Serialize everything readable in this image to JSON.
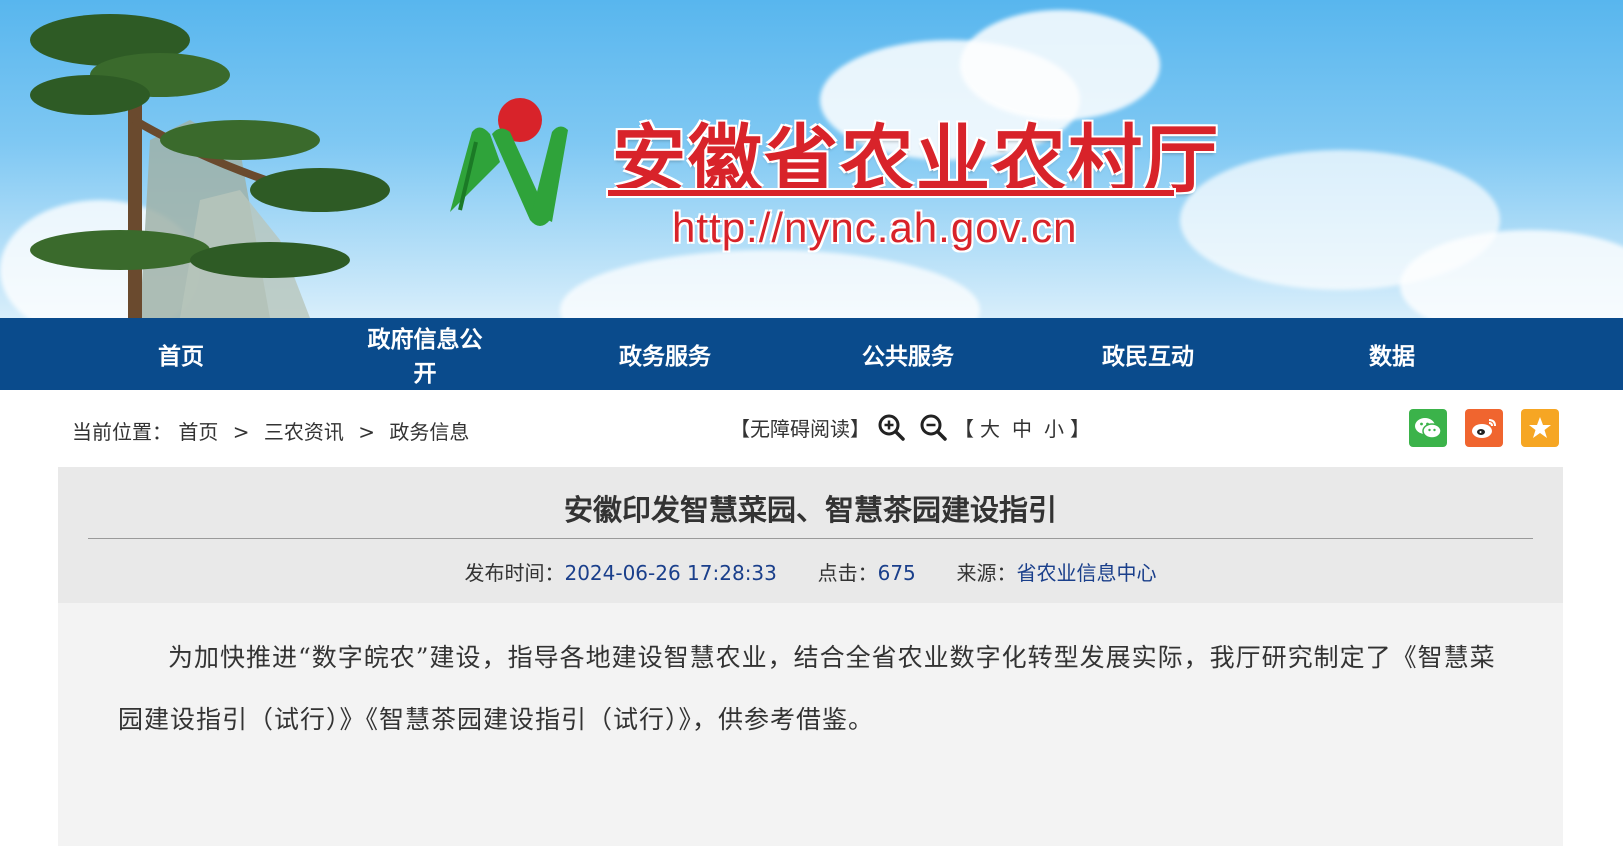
{
  "header": {
    "site_title": "安徽省农业农村厅",
    "site_url": "http://nync.ah.gov.cn"
  },
  "nav": {
    "items": [
      {
        "label": "首页"
      },
      {
        "label": "政府信息公开"
      },
      {
        "label": "政务服务"
      },
      {
        "label": "公共服务"
      },
      {
        "label": "政民互动"
      },
      {
        "label": "数据"
      }
    ]
  },
  "breadcrumb": {
    "prefix": "当前位置：",
    "items": [
      "首页",
      "三农资讯",
      "政务信息"
    ],
    "separator": ">"
  },
  "accessibility": {
    "barrier_free": "【无障碍阅读】",
    "zoom_in_icon": "zoom-in-icon",
    "zoom_out_icon": "zoom-out-icon",
    "bracket_open": "【",
    "bracket_close": "】",
    "size_large": "大",
    "size_medium": "中",
    "size_small": "小"
  },
  "share": {
    "wechat_color": "#3bb34a",
    "weibo_color": "#f0652f",
    "favorite_color": "#f6a623"
  },
  "article": {
    "title": "安徽印发智慧菜园、智慧茶园建设指引",
    "publish_label": "发布时间：",
    "publish_time": "2024-06-26 17:28:33",
    "clicks_label": "点击：",
    "clicks": "675",
    "source_label": "来源：",
    "source": "省农业信息中心",
    "body": "为加快推进“数字皖农”建设，指导各地建设智慧农业，结合全省农业数字化转型发展实际，我厅研究制定了《智慧菜园建设指引（试行）》《智慧茶园建设指引（试行）》，供参考借鉴。"
  },
  "colors": {
    "nav_bg": "#0a4b8c",
    "title_red": "#d8232a",
    "meta_value": "#1a3f8b"
  }
}
